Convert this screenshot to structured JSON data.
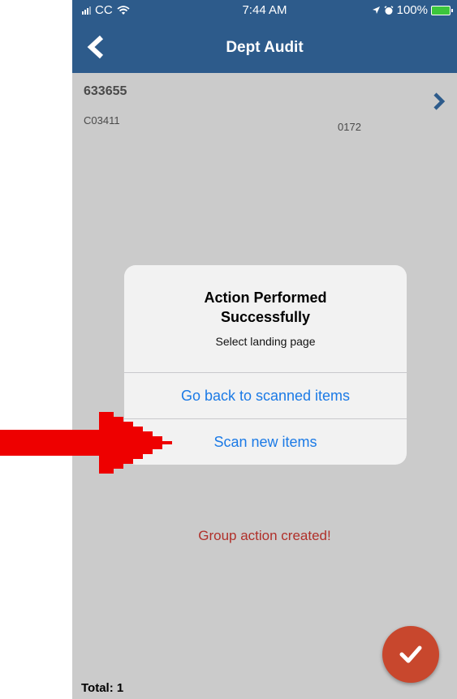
{
  "status_bar": {
    "carrier": "CC",
    "time": "7:44 AM",
    "battery": "100%"
  },
  "nav": {
    "title": "Dept Audit"
  },
  "item": {
    "id": "633655",
    "code": "C03411",
    "number": "0172"
  },
  "alert": {
    "title_line1": "Action Performed",
    "title_line2": "Successfully",
    "message": "Select landing page",
    "buttons": [
      "Go back to scanned items",
      "Scan new items"
    ]
  },
  "toast": "Group action created!",
  "footer": {
    "total": "Total: 1"
  },
  "colors": {
    "nav_bg": "#2d5b8b",
    "screen_bg": "#cbcbcb",
    "alert_action": "#1b7ae6",
    "toast_text": "#b0302a",
    "fab_bg": "#c8472d",
    "annotation_arrow": "#ee0000"
  },
  "icons": {
    "back": "chevron-left-icon",
    "row": "chevron-right-icon",
    "fab": "checkmark-icon",
    "annotation": "red-arrow-icon"
  }
}
